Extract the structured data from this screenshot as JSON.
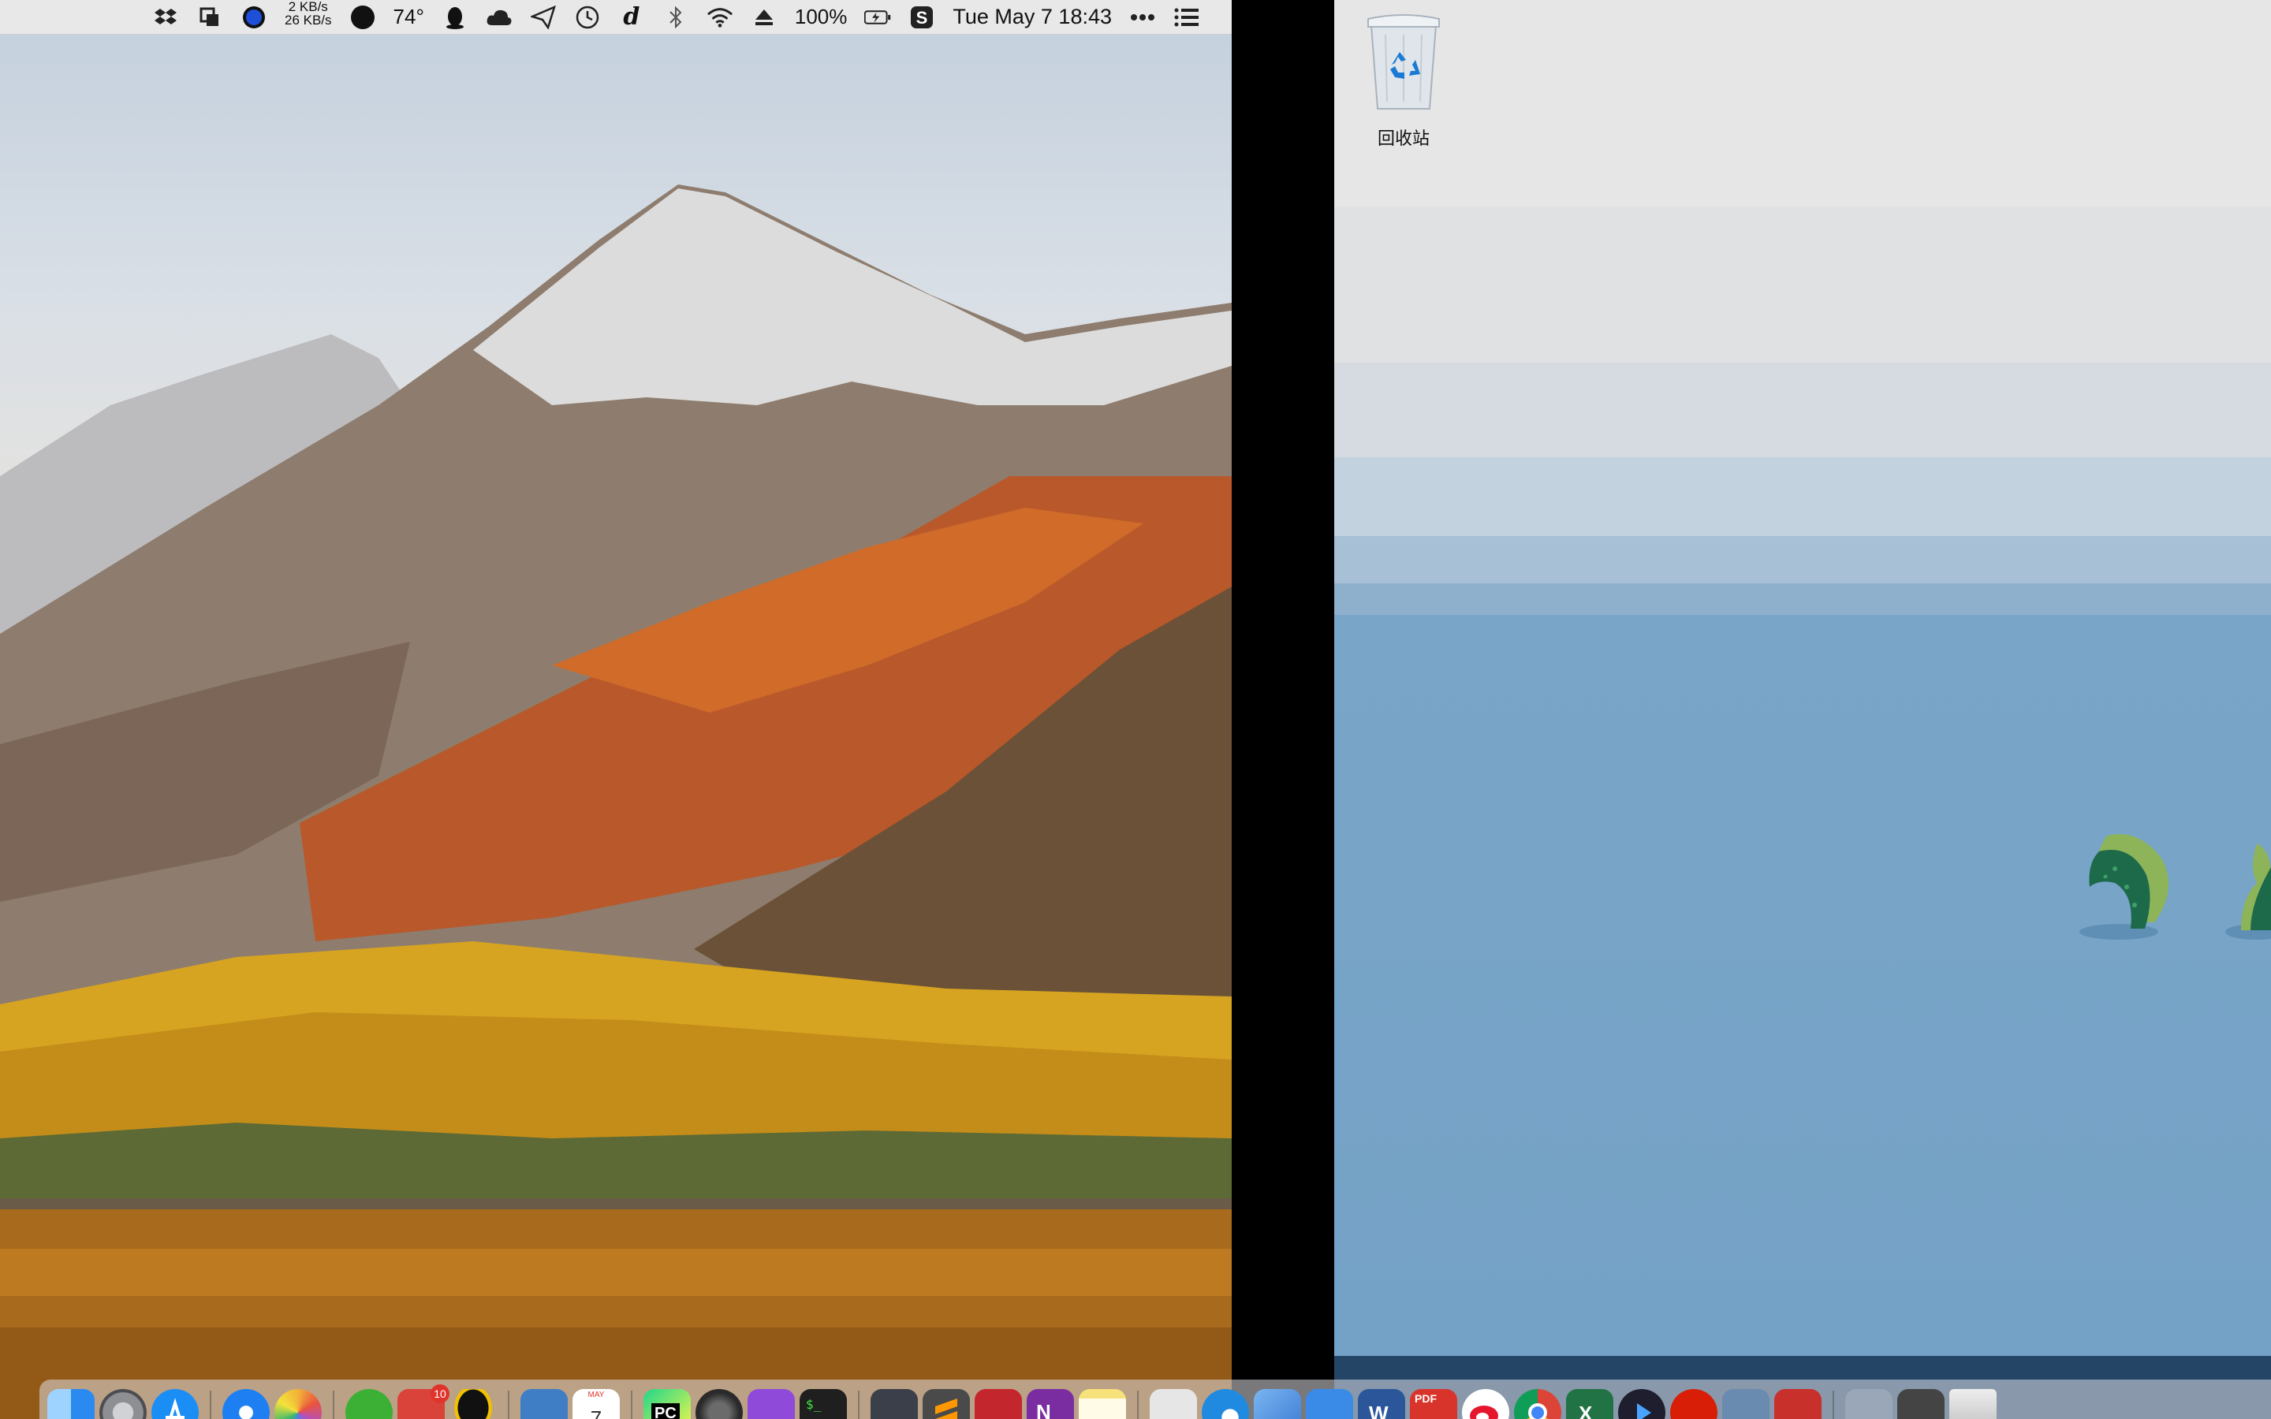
{
  "menubar": {
    "net_speed_up": "2 KB/s",
    "net_speed_down": "26 KB/s",
    "temperature": "74°",
    "dictionary_glyph": "d",
    "battery_percent": "100%",
    "datetime": "Tue May 7  18:43",
    "icons": [
      "dropbox-icon",
      "screen-capture-icon",
      "istat-icon",
      "weather-moon-icon",
      "qq-penguin-icon",
      "cloud-icon",
      "send-icon",
      "time-machine-icon",
      "dictionary-icon",
      "bluetooth-icon",
      "wifi-icon",
      "eject-icon",
      "battery-icon",
      "s-app-icon",
      "more-icon",
      "list-icon"
    ]
  },
  "windows_desktop": {
    "recycle_bin_label": "回收站"
  },
  "dock": {
    "calendar_month": "MAY",
    "calendar_day": "7",
    "todoist_badge": "10",
    "pycharm_label": "PC",
    "terminal_label": "$_",
    "word_label": "W",
    "excel_label": "X",
    "onenote_label": "N",
    "pdf_label": "PDF",
    "colors": {
      "finder": "#2b8af0",
      "prefs": "#8d8f93",
      "appstore": "#1a8ef5",
      "safari": "#1d7ff2",
      "photos": "#f3b23a",
      "wechat": "#3cb035",
      "todoist": "#d9433a",
      "qq": "#111111",
      "preview": "#3f7dc5",
      "calendar": "#ffffff",
      "pycharm": "#21d789",
      "alfred": "#4a4a4a",
      "pockity": "#8f4ad9",
      "terminal": "#1f1f1f",
      "sublime": "#ff9800",
      "mendeley": "#c4262e",
      "onenote": "#7a2da0",
      "notes": "#f7e17a",
      "windows_doc": "#e6e6e6",
      "edge": "#1f8ae0",
      "parallels": "#3a7bd5",
      "xcode": "#3a8be8",
      "word": "#2b579a",
      "acrobat": "#d9342b",
      "weibo": "#e6162d",
      "chrome": "#4285f4",
      "excel": "#217346",
      "media": "#1e1e2e",
      "netease": "#d81e06",
      "storage": "#6a8bb0",
      "remote": "#c7302b",
      "downloads": "#9aa7b8",
      "stack": "#444",
      "trash": "#c9c9c9"
    }
  }
}
